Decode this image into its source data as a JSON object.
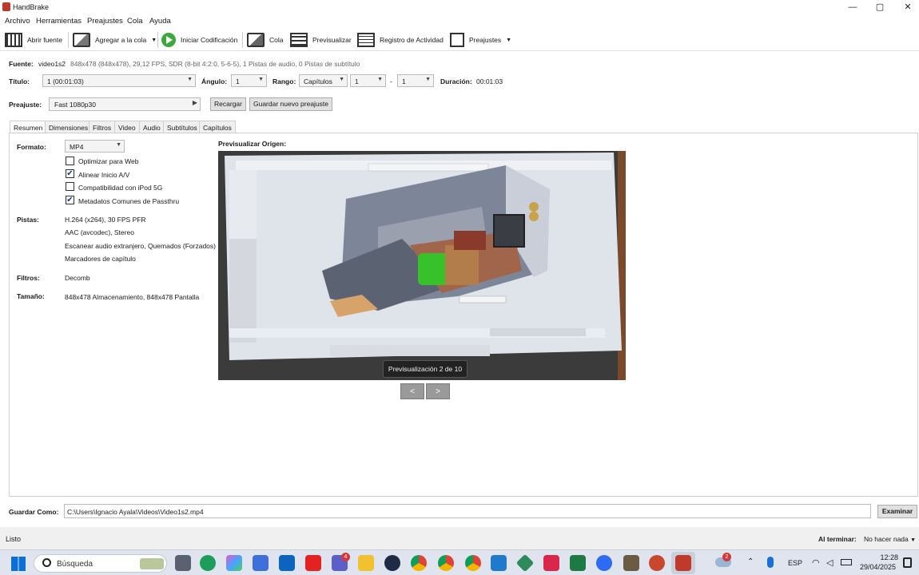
{
  "window": {
    "title": "HandBrake",
    "minimize": "—",
    "maximize": "▢",
    "close": "✕"
  },
  "menu": [
    "Archivo",
    "Herramientas",
    "Preajustes",
    "Cola",
    "Ayuda"
  ],
  "toolbar": {
    "open_source": "Abrir fuente",
    "add_queue": "Agregar a la cola",
    "start_encode": "Iniciar Codificación",
    "queue": "Cola",
    "preview": "Previsualizar",
    "activity_log": "Registro de Actividad",
    "presets": "Preajustes"
  },
  "source": {
    "label": "Fuente:",
    "name": "video1s2",
    "details": "848x478 (848x478), 29,12 FPS, SDR (8-bit 4:2:0, 5-6-5), 1 Pistas de audio, 0 Pistas de subtítulo"
  },
  "title_row": {
    "title_label": "Título:",
    "title_value": "1  (00:01:03)",
    "angle_label": "Ángulo:",
    "angle_value": "1",
    "range_label": "Rango:",
    "range_type": "Capítulos",
    "range_start": "1",
    "range_sep": "-",
    "range_end": "1",
    "duration_label": "Duración:",
    "duration_value": "00:01:03"
  },
  "preset_row": {
    "label": "Preajuste:",
    "value": "Fast 1080p30",
    "reload": "Recargar",
    "save_new": "Guardar nuevo preajuste"
  },
  "tabs": [
    "Resumen",
    "Dimensiones",
    "Filtros",
    "Video",
    "Audio",
    "Subtítulos",
    "Capítulos"
  ],
  "summary": {
    "format_label": "Formato:",
    "format_value": "MP4",
    "options": [
      {
        "label": "Optimizar para Web",
        "checked": false
      },
      {
        "label": "Alinear Inicio A/V",
        "checked": true
      },
      {
        "label": "Compatibilidad con iPod 5G",
        "checked": false
      },
      {
        "label": "Metadatos Comunes de Passthru",
        "checked": true
      }
    ],
    "tracks_label": "Pistas:",
    "tracks": [
      "H.264 (x264), 30 FPS PFR",
      "AAC (avcodec), Stereo",
      "Escanear audio extranjero, Quemados (Forzados)",
      "Marcadores de capítulo"
    ],
    "filters_label": "Filtros:",
    "filters_value": "Decomb",
    "size_label": "Tamaño:",
    "size_value": "848x478 Almacenamiento, 848x478 Pantalla"
  },
  "preview": {
    "heading": "Previsualizar Origen:",
    "counter": "Previsualización 2 de 10",
    "prev": "<",
    "next": ">"
  },
  "save_as": {
    "label": "Guardar Como:",
    "path": "C:\\Users\\Ignacio Ayala\\Videos\\Video1s2.mp4",
    "browse": "Examinar"
  },
  "status": {
    "text": "Listo",
    "when_done_label": "Al terminar:",
    "when_done_value": "No hacer nada"
  },
  "taskbar": {
    "search_placeholder": "Búsqueda",
    "teams_badge": "4",
    "weather_badge": "2",
    "language": "ESP",
    "time": "12:28",
    "date": "29/04/2025"
  }
}
